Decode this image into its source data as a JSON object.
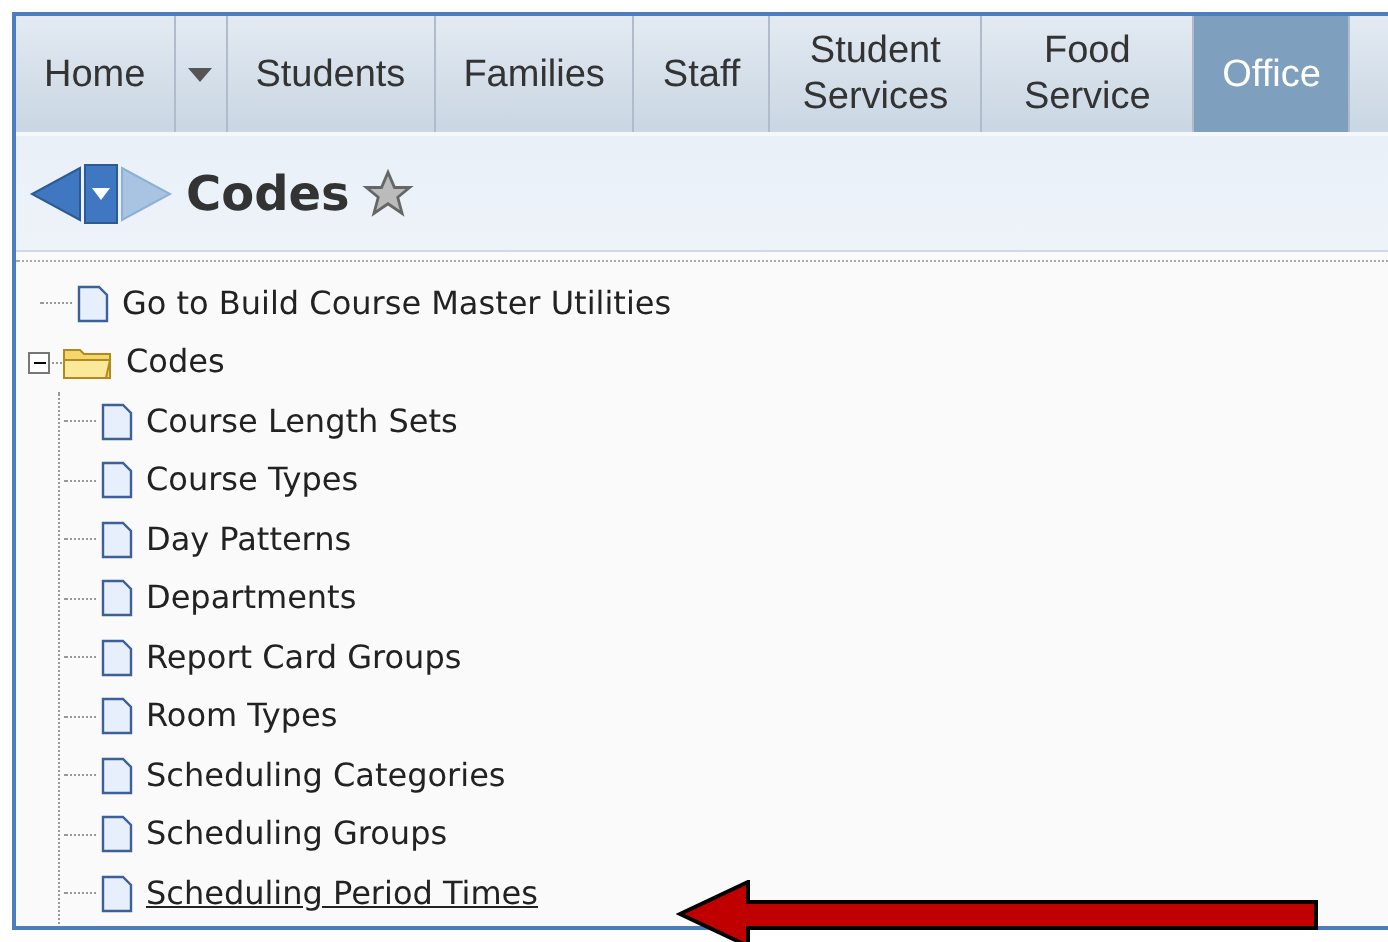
{
  "tabs": [
    {
      "kind": "tab",
      "label": "Home",
      "selected": false
    },
    {
      "kind": "dropdown",
      "selected": false
    },
    {
      "kind": "tab",
      "label": "Students",
      "selected": false
    },
    {
      "kind": "tab",
      "label": "Families",
      "selected": false
    },
    {
      "kind": "tab",
      "label": "Staff",
      "selected": false
    },
    {
      "kind": "tab",
      "label": "Student Services",
      "selected": false
    },
    {
      "kind": "tab",
      "label": "Food Service",
      "selected": false
    },
    {
      "kind": "tab",
      "label": "Office",
      "selected": true
    }
  ],
  "header": {
    "title": "Codes"
  },
  "tree": [
    {
      "label": "Go to Build Course Master Utilities",
      "kind": "page",
      "hovered": false
    },
    {
      "label": "Codes",
      "kind": "folder",
      "expanded": true,
      "children": [
        {
          "label": "Course Length Sets",
          "kind": "page",
          "hovered": false
        },
        {
          "label": "Course Types",
          "kind": "page",
          "hovered": false
        },
        {
          "label": "Day Patterns",
          "kind": "page",
          "hovered": false
        },
        {
          "label": "Departments",
          "kind": "page",
          "hovered": false
        },
        {
          "label": "Report Card Groups",
          "kind": "page",
          "hovered": false
        },
        {
          "label": "Room Types",
          "kind": "page",
          "hovered": false
        },
        {
          "label": "Scheduling Categories",
          "kind": "page",
          "hovered": false
        },
        {
          "label": "Scheduling Groups",
          "kind": "page",
          "hovered": false
        },
        {
          "label": "Scheduling Period Times",
          "kind": "page",
          "hovered": true
        }
      ]
    }
  ]
}
